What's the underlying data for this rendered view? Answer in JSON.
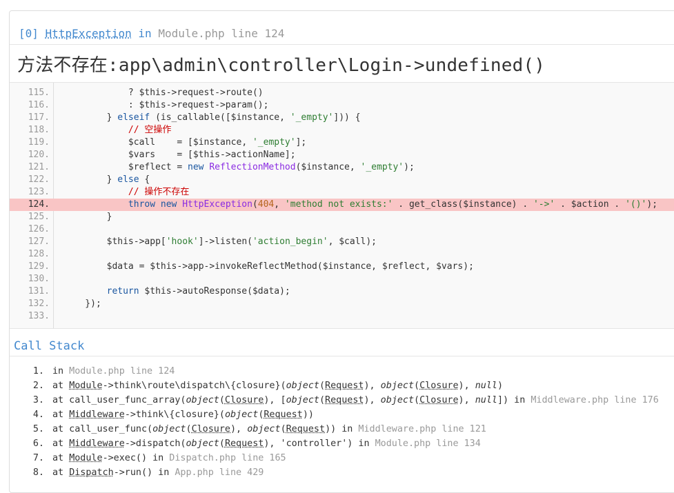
{
  "exception": {
    "index": "[0]",
    "class_name": "HttpException",
    "in_word": "in",
    "location": "Module.php line 124",
    "message": "方法不存在:app\\admin\\controller\\Login->undefined()"
  },
  "source": {
    "highlight_line": "124.",
    "lines": [
      {
        "num": "115.",
        "code": "            ? $this->request->route()"
      },
      {
        "num": "116.",
        "code": "            : $this->request->param();"
      },
      {
        "num": "117.",
        "code": "        } elseif (is_callable([$instance, '_empty'])) {"
      },
      {
        "num": "118.",
        "code": "            // 空操作"
      },
      {
        "num": "119.",
        "code": "            $call    = [$instance, '_empty'];"
      },
      {
        "num": "120.",
        "code": "            $vars    = [$this->actionName];"
      },
      {
        "num": "121.",
        "code": "            $reflect = new ReflectionMethod($instance, '_empty');"
      },
      {
        "num": "122.",
        "code": "        } else {"
      },
      {
        "num": "123.",
        "code": "            // 操作不存在"
      },
      {
        "num": "124.",
        "code": "            throw new HttpException(404, 'method not exists:' . get_class($instance) . '->' . $action . '()');"
      },
      {
        "num": "125.",
        "code": "        }"
      },
      {
        "num": "126.",
        "code": ""
      },
      {
        "num": "127.",
        "code": "        $this->app['hook']->listen('action_begin', $call);"
      },
      {
        "num": "128.",
        "code": ""
      },
      {
        "num": "129.",
        "code": "        $data = $this->app->invokeReflectMethod($instance, $reflect, $vars);"
      },
      {
        "num": "130.",
        "code": ""
      },
      {
        "num": "131.",
        "code": "        return $this->autoResponse($data);"
      },
      {
        "num": "132.",
        "code": "    });"
      },
      {
        "num": "133.",
        "code": ""
      }
    ]
  },
  "call_stack": {
    "title": "Call Stack",
    "items": [
      {
        "num": "1.",
        "text": "in",
        "location": "Module.php line 124"
      },
      {
        "num": "2.",
        "text": "at Module->think\\route\\dispatch\\{closure}(object(Request), object(Closure), null)"
      },
      {
        "num": "3.",
        "text": "at call_user_func_array(object(Closure), [object(Request), object(Closure), null]) in",
        "location": "Middleware.php line 176"
      },
      {
        "num": "4.",
        "text": "at Middleware->think\\{closure}(object(Request))"
      },
      {
        "num": "5.",
        "text": "at call_user_func(object(Closure), object(Request)) in",
        "location": "Middleware.php line 121"
      },
      {
        "num": "6.",
        "text": "at Middleware->dispatch(object(Request), 'controller') in",
        "location": "Module.php line 134"
      },
      {
        "num": "7.",
        "text": "at Module->exec() in",
        "location": "Dispatch.php line 165"
      },
      {
        "num": "8.",
        "text": "at Dispatch->run() in",
        "location": "App.php line 429"
      }
    ]
  },
  "colors": {
    "accent": "#4288ce",
    "highlight": "#f9c5c5",
    "muted": "#999999"
  }
}
